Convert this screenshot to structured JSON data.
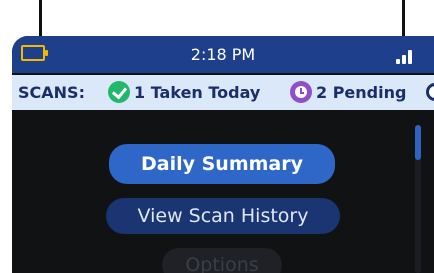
{
  "status_bar": {
    "time": "2:18 PM",
    "battery_icon": "battery-icon",
    "signal_icon": "signal-icon"
  },
  "scans": {
    "label": "SCANS:",
    "taken_text": "1 Taken Today",
    "taken_icon": "check-circle-icon",
    "pending_text": "2 Pending",
    "pending_icon": "clock-circle-icon"
  },
  "menu": {
    "items": [
      {
        "label": "Daily Summary",
        "selected": true
      },
      {
        "label": "View Scan History",
        "selected": false
      },
      {
        "label": "Options",
        "selected": false
      }
    ]
  },
  "colors": {
    "status_bar": "#1e3f8b",
    "scans_bar": "#dbe8fa",
    "selected_button": "#2e67c8",
    "button": "#1a3572",
    "battery": "#f5b800",
    "taken": "#22b86b",
    "pending": "#8f4fc8"
  }
}
